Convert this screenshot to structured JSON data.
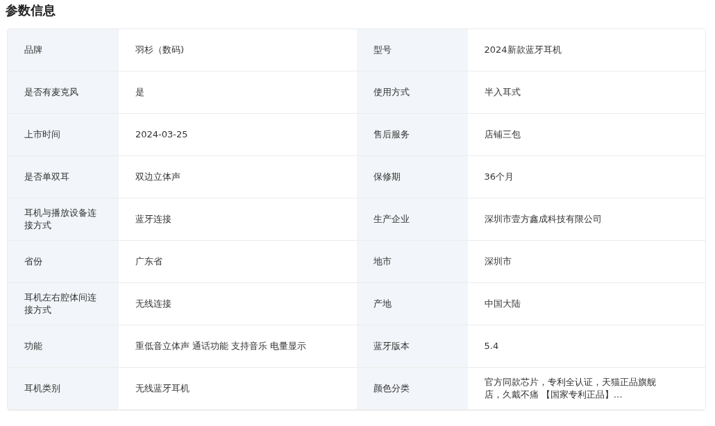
{
  "title": "参数信息",
  "rows": [
    [
      {
        "label": "品牌",
        "value": "羽杉（数码)"
      },
      {
        "label": "型号",
        "value": "2024新款蓝牙耳机"
      }
    ],
    [
      {
        "label": "是否有麦克风",
        "value": "是"
      },
      {
        "label": "使用方式",
        "value": "半入耳式"
      }
    ],
    [
      {
        "label": "上市时间",
        "value": "2024-03-25"
      },
      {
        "label": "售后服务",
        "value": "店铺三包"
      }
    ],
    [
      {
        "label": "是否单双耳",
        "value": "双边立体声"
      },
      {
        "label": "保修期",
        "value": "36个月"
      }
    ],
    [
      {
        "label": "耳机与播放设备连接方式",
        "value": "蓝牙连接"
      },
      {
        "label": "生产企业",
        "value": "深圳市壹方鑫成科技有限公司"
      }
    ],
    [
      {
        "label": "省份",
        "value": "广东省"
      },
      {
        "label": "地市",
        "value": "深圳市"
      }
    ],
    [
      {
        "label": "耳机左右腔体间连接方式",
        "value": "无线连接"
      },
      {
        "label": "产地",
        "value": "中国大陆"
      }
    ],
    [
      {
        "label": "功能",
        "value": "重低音立体声 通话功能 支持音乐 电量显示"
      },
      {
        "label": "蓝牙版本",
        "value": "5.4"
      }
    ],
    [
      {
        "label": "耳机类别",
        "value": "无线蓝牙耳机"
      },
      {
        "label": "颜色分类",
        "value": "官方同款芯片，专利全认证，天猫正品旗舰店，久戴不痛 【国家专利正品】…"
      }
    ]
  ]
}
